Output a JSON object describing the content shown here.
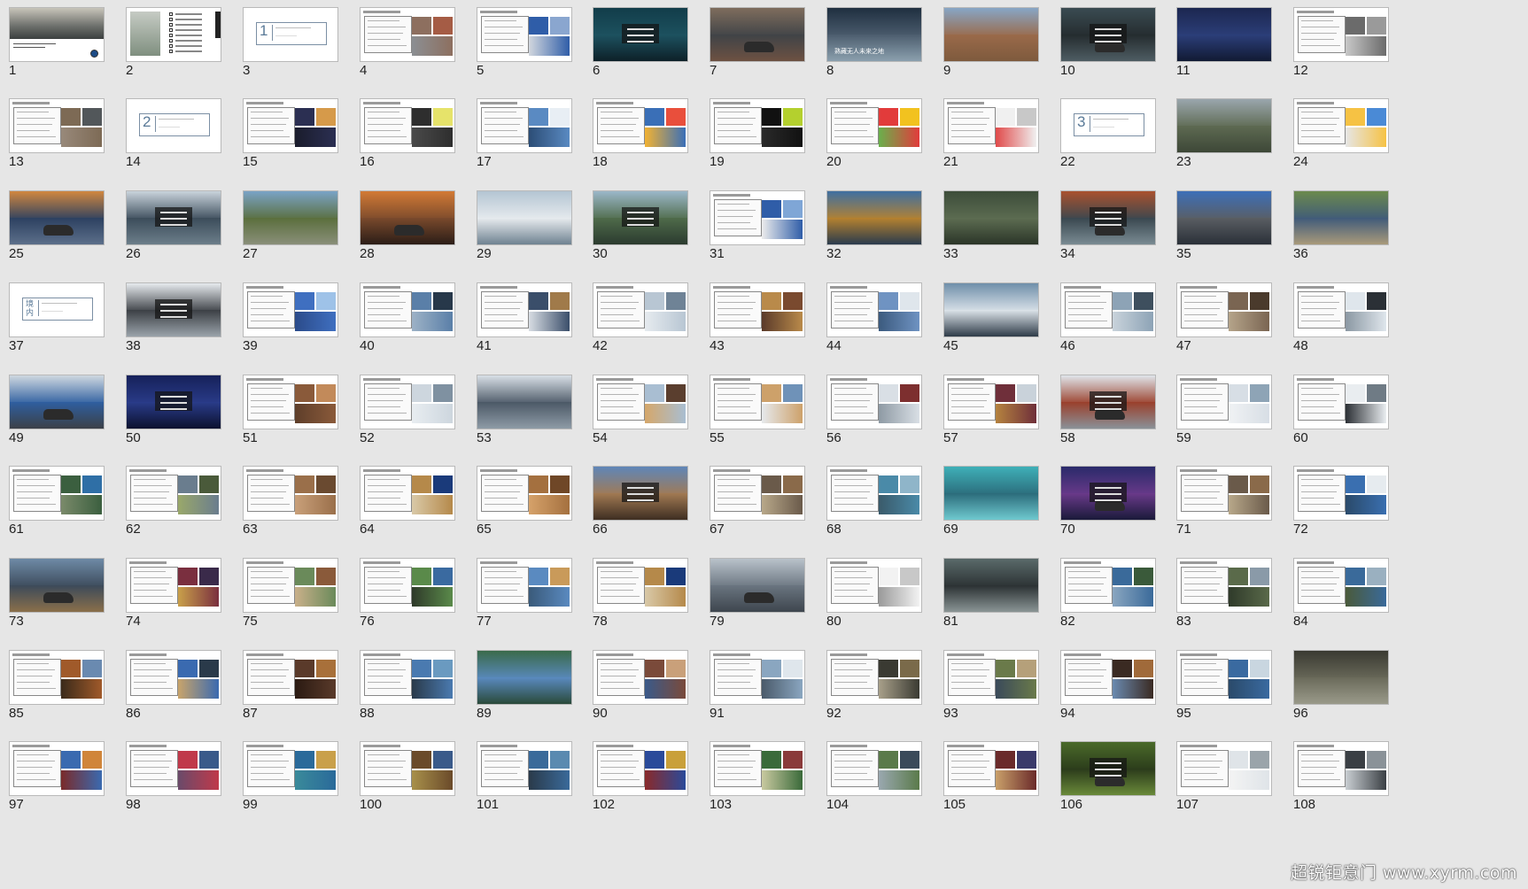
{
  "slide_sorter": {
    "slides": [
      {
        "n": "1",
        "k": "cover",
        "c": [
          "#6b6e6a",
          "#c8c4ba",
          "#3b3f3f"
        ]
      },
      {
        "n": "2",
        "k": "toc",
        "c": [
          "#7f8f7f",
          "#c6cbc4",
          "#6b7a68"
        ]
      },
      {
        "n": "3",
        "k": "section",
        "num": "1",
        "c": []
      },
      {
        "n": "4",
        "k": "white",
        "c": [
          "#8d6f5f",
          "#a55c45",
          "#8b8f93"
        ]
      },
      {
        "n": "5",
        "k": "white",
        "c": [
          "#2f5da8",
          "#8aa6cf",
          "#d2d7de"
        ]
      },
      {
        "n": "6",
        "k": "photo",
        "c": [
          "#123d4a",
          "#1d5260",
          "#0d2028"
        ]
      },
      {
        "n": "7",
        "k": "photo",
        "c": [
          "#7f6d5d",
          "#3f4347",
          "#6d5142"
        ]
      },
      {
        "n": "8",
        "k": "photo",
        "c": [
          "#1f2f40",
          "#4c5d6e",
          "#8ba0ae"
        ],
        "t": "熟藏无人未来之地"
      },
      {
        "n": "9",
        "k": "photo",
        "c": [
          "#87a6c6",
          "#9a6a4a",
          "#7e5a3d"
        ]
      },
      {
        "n": "10",
        "k": "photo",
        "c": [
          "#3a4b52",
          "#242b2e",
          "#4e5d63"
        ]
      },
      {
        "n": "11",
        "k": "photo",
        "c": [
          "#1c2750",
          "#2c3f7a",
          "#111a33"
        ]
      },
      {
        "n": "12",
        "k": "white",
        "c": [
          "#6b6b6b",
          "#9a9a9a",
          "#c8c8c8"
        ]
      },
      {
        "n": "13",
        "k": "white",
        "c": [
          "#7d6a55",
          "#52575a",
          "#98897a"
        ]
      },
      {
        "n": "14",
        "k": "section",
        "num": "2",
        "c": []
      },
      {
        "n": "15",
        "k": "white",
        "c": [
          "#2b2f52",
          "#d69a4a",
          "#1a1c2c"
        ]
      },
      {
        "n": "16",
        "k": "white",
        "c": [
          "#2e2e2e",
          "#e6e36a",
          "#4a4a4a"
        ]
      },
      {
        "n": "17",
        "k": "white",
        "c": [
          "#5a8ac2",
          "#e8eef4",
          "#2c4d76"
        ]
      },
      {
        "n": "18",
        "k": "white",
        "c": [
          "#3a6fb7",
          "#e94f3c",
          "#f2b233"
        ]
      },
      {
        "n": "19",
        "k": "white",
        "c": [
          "#111111",
          "#b4d02e",
          "#2a2a2a"
        ]
      },
      {
        "n": "20",
        "k": "white",
        "c": [
          "#e23b3b",
          "#f2c21f",
          "#6ab04c"
        ]
      },
      {
        "n": "21",
        "k": "white",
        "c": [
          "#f0f0f0",
          "#c8c8c8",
          "#e04a4a"
        ]
      },
      {
        "n": "22",
        "k": "section",
        "num": "3",
        "c": []
      },
      {
        "n": "23",
        "k": "photo",
        "c": [
          "#9aa6ad",
          "#5e6a52",
          "#3d4737"
        ]
      },
      {
        "n": "24",
        "k": "white",
        "c": [
          "#f6c244",
          "#4a8ad6",
          "#e6e6e6"
        ]
      },
      {
        "n": "25",
        "k": "photo",
        "c": [
          "#d1873f",
          "#2c4060",
          "#5c6f8a"
        ]
      },
      {
        "n": "26",
        "k": "photo",
        "c": [
          "#c9d3dc",
          "#3b4c5a",
          "#6c7e8a"
        ]
      },
      {
        "n": "27",
        "k": "photo",
        "c": [
          "#7aa3c6",
          "#5a6e3c",
          "#8a8f7a"
        ]
      },
      {
        "n": "28",
        "k": "photo",
        "c": [
          "#d27a35",
          "#7a4a2c",
          "#2b1d17"
        ]
      },
      {
        "n": "29",
        "k": "photo",
        "c": [
          "#b4c5d3",
          "#e8ecef",
          "#6f8291"
        ]
      },
      {
        "n": "30",
        "k": "photo",
        "c": [
          "#9bb7c9",
          "#4f6b4a",
          "#2b3b2f"
        ]
      },
      {
        "n": "31",
        "k": "white",
        "c": [
          "#2f5da8",
          "#7fa6d6",
          "#ececec"
        ]
      },
      {
        "n": "32",
        "k": "photo",
        "c": [
          "#3f6fa1",
          "#b7822e",
          "#2a3b4d"
        ]
      },
      {
        "n": "33",
        "k": "photo",
        "c": [
          "#3d4d3a",
          "#5d6d52",
          "#2b3528"
        ]
      },
      {
        "n": "34",
        "k": "photo",
        "c": [
          "#a9522f",
          "#39474f",
          "#7a8b93"
        ]
      },
      {
        "n": "35",
        "k": "photo",
        "c": [
          "#3d6fb8",
          "#5a5e63",
          "#2a3038"
        ]
      },
      {
        "n": "36",
        "k": "photo",
        "c": [
          "#6c8a4d",
          "#3f5a7a",
          "#a99a7a"
        ]
      },
      {
        "n": "37",
        "k": "section",
        "num": "境内",
        "c": []
      },
      {
        "n": "38",
        "k": "photo",
        "c": [
          "#e6eaee",
          "#3b3f44",
          "#9aa3aa"
        ]
      },
      {
        "n": "39",
        "k": "white",
        "c": [
          "#3f6fc0",
          "#9ec2e8",
          "#2b4b8a"
        ]
      },
      {
        "n": "40",
        "k": "white",
        "c": [
          "#5a7fa8",
          "#27384a",
          "#9db2c6"
        ]
      },
      {
        "n": "41",
        "k": "white",
        "c": [
          "#3a4e6a",
          "#a07a4a",
          "#d8dde3"
        ]
      },
      {
        "n": "42",
        "k": "white",
        "c": [
          "#b8c6d3",
          "#6f8396",
          "#e6ebef"
        ]
      },
      {
        "n": "43",
        "k": "white",
        "c": [
          "#b98a4a",
          "#7a4a2f",
          "#5a3a2a"
        ]
      },
      {
        "n": "44",
        "k": "white",
        "c": [
          "#6f93c2",
          "#dfe6ec",
          "#3b5a7e"
        ]
      },
      {
        "n": "45",
        "k": "photo",
        "c": [
          "#6f8faa",
          "#dde4ea",
          "#2e3b48"
        ]
      },
      {
        "n": "46",
        "k": "white",
        "c": [
          "#8da3b6",
          "#3e4f5e",
          "#c9d3db"
        ]
      },
      {
        "n": "47",
        "k": "white",
        "c": [
          "#7a6552",
          "#4a3a2c",
          "#b5a48a"
        ]
      },
      {
        "n": "48",
        "k": "white",
        "c": [
          "#dfe6ec",
          "#2b3036",
          "#8b98a3"
        ]
      },
      {
        "n": "49",
        "k": "photo",
        "c": [
          "#cfd8e0",
          "#2f5fa0",
          "#3b4047"
        ]
      },
      {
        "n": "50",
        "k": "photo",
        "c": [
          "#16215a",
          "#2a3c8a",
          "#0b112e"
        ]
      },
      {
        "n": "51",
        "k": "white",
        "c": [
          "#8a5a3a",
          "#c28a5a",
          "#5e3e2a"
        ]
      },
      {
        "n": "52",
        "k": "white",
        "c": [
          "#cdd6de",
          "#7f91a1",
          "#e8edf1"
        ]
      },
      {
        "n": "53",
        "k": "photo",
        "c": [
          "#d8dfe6",
          "#4b5866",
          "#8e9ba6"
        ]
      },
      {
        "n": "54",
        "k": "white",
        "c": [
          "#a9bed2",
          "#5a3e2e",
          "#d5a76a"
        ]
      },
      {
        "n": "55",
        "k": "white",
        "c": [
          "#cda16a",
          "#6f92b8",
          "#e6e9ec"
        ]
      },
      {
        "n": "56",
        "k": "white",
        "c": [
          "#d9dfe5",
          "#7d2f2f",
          "#8e9aa4"
        ]
      },
      {
        "n": "57",
        "k": "white",
        "c": [
          "#6f2f3a",
          "#c9d2da",
          "#b5833f"
        ]
      },
      {
        "n": "58",
        "k": "photo",
        "c": [
          "#dfe5ea",
          "#9a3f2b",
          "#8a9198"
        ]
      },
      {
        "n": "59",
        "k": "white",
        "c": [
          "#d7dee5",
          "#8ea4b6",
          "#f0f2f4"
        ]
      },
      {
        "n": "60",
        "k": "white",
        "c": [
          "#e9edf0",
          "#6f7b85",
          "#2c3035"
        ]
      },
      {
        "n": "61",
        "k": "white",
        "c": [
          "#3b5f3f",
          "#2f6fa6",
          "#7a8a6a"
        ]
      },
      {
        "n": "62",
        "k": "white",
        "c": [
          "#6a7d8e",
          "#4a5a3a",
          "#9aa86a"
        ]
      },
      {
        "n": "63",
        "k": "white",
        "c": [
          "#9a6f4a",
          "#6a4a30",
          "#c9a07a"
        ]
      },
      {
        "n": "64",
        "k": "white",
        "c": [
          "#b5894a",
          "#1a3a7a",
          "#d9c9a8"
        ]
      },
      {
        "n": "65",
        "k": "white",
        "c": [
          "#a4703f",
          "#6f4727",
          "#d6a26a"
        ]
      },
      {
        "n": "66",
        "k": "photo",
        "c": [
          "#5f86b8",
          "#a27a53",
          "#3e2e22"
        ]
      },
      {
        "n": "67",
        "k": "white",
        "c": [
          "#6a5a4a",
          "#8a6a4a",
          "#b8a88a"
        ]
      },
      {
        "n": "68",
        "k": "white",
        "c": [
          "#4a8aa8",
          "#8fb5c9",
          "#3a5a6a"
        ]
      },
      {
        "n": "69",
        "k": "photo",
        "c": [
          "#3fb0b8",
          "#2b6b7a",
          "#6fc9cf"
        ]
      },
      {
        "n": "70",
        "k": "photo",
        "c": [
          "#2a2a6a",
          "#6a3a8a",
          "#1a1a3a"
        ]
      },
      {
        "n": "71",
        "k": "white",
        "c": [
          "#6a5a4a",
          "#8a6a4a",
          "#b8a88a"
        ]
      },
      {
        "n": "72",
        "k": "white",
        "c": [
          "#3a6fb0",
          "#e6ebef",
          "#2a4a6a"
        ]
      },
      {
        "n": "73",
        "k": "photo",
        "c": [
          "#6e8aa6",
          "#3c4a5a",
          "#8a6f4a"
        ]
      },
      {
        "n": "74",
        "k": "white",
        "c": [
          "#7a2f3f",
          "#3a2a4a",
          "#c9a04a"
        ]
      },
      {
        "n": "75",
        "k": "white",
        "c": [
          "#6a8a5a",
          "#8a5a3a",
          "#c9b08a"
        ]
      },
      {
        "n": "76",
        "k": "white",
        "c": [
          "#5a8a4a",
          "#3a6aa0",
          "#2f3a2a"
        ]
      },
      {
        "n": "77",
        "k": "white",
        "c": [
          "#5a8ac0",
          "#c99a5a",
          "#3a5a7a"
        ]
      },
      {
        "n": "78",
        "k": "white",
        "c": [
          "#b5894a",
          "#1a3a7a",
          "#d9c9a8"
        ]
      },
      {
        "n": "79",
        "k": "photo",
        "c": [
          "#b9c2ca",
          "#6a7580",
          "#3e464e"
        ]
      },
      {
        "n": "80",
        "k": "white",
        "c": [
          "#f2f2f2",
          "#c8c8c8",
          "#9a9a9a"
        ]
      },
      {
        "n": "81",
        "k": "photo",
        "c": [
          "#5a6a6a",
          "#2a3032",
          "#8a9595"
        ]
      },
      {
        "n": "82",
        "k": "white",
        "c": [
          "#3a6a9a",
          "#3a5a3a",
          "#8aa6c0"
        ]
      },
      {
        "n": "83",
        "k": "white",
        "c": [
          "#5a6a4a",
          "#8a9aa8",
          "#2f3a2a"
        ]
      },
      {
        "n": "84",
        "k": "white",
        "c": [
          "#3a6a9a",
          "#9ab0c0",
          "#4a5a3a"
        ]
      },
      {
        "n": "85",
        "k": "white",
        "c": [
          "#a05a2a",
          "#6a8ab0",
          "#3a2a1a"
        ]
      },
      {
        "n": "86",
        "k": "white",
        "c": [
          "#3a6ab0",
          "#2a3a4a",
          "#c9a46a"
        ]
      },
      {
        "n": "87",
        "k": "white",
        "c": [
          "#5a3a2a",
          "#a8703a",
          "#2a1a12"
        ]
      },
      {
        "n": "88",
        "k": "white",
        "c": [
          "#4a7ab0",
          "#6a9ac0",
          "#2a3a4a"
        ]
      },
      {
        "n": "89",
        "k": "photo",
        "c": [
          "#3a6a4a",
          "#5a8ac0",
          "#2a4a3a"
        ]
      },
      {
        "n": "90",
        "k": "white",
        "c": [
          "#7a4a3a",
          "#c9a07a",
          "#3a5a8a"
        ]
      },
      {
        "n": "91",
        "k": "white",
        "c": [
          "#8aa6c0",
          "#dfe6ec",
          "#4a5a6a"
        ]
      },
      {
        "n": "92",
        "k": "white",
        "c": [
          "#3a3a32",
          "#7a6a4a",
          "#a8a08a"
        ]
      },
      {
        "n": "93",
        "k": "white",
        "c": [
          "#6a7a4a",
          "#b5a07a",
          "#3a4a5a"
        ]
      },
      {
        "n": "94",
        "k": "white",
        "c": [
          "#3a2a22",
          "#a06a3a",
          "#6a8ab0"
        ]
      },
      {
        "n": "95",
        "k": "white",
        "c": [
          "#3a6aa0",
          "#c9d6e0",
          "#2a4a6a"
        ]
      },
      {
        "n": "96",
        "k": "photo",
        "c": [
          "#3a3a32",
          "#6a6a5a",
          "#9a9a8a"
        ]
      },
      {
        "n": "97",
        "k": "white",
        "c": [
          "#3a6ab0",
          "#d0853a",
          "#7a2a2a"
        ]
      },
      {
        "n": "98",
        "k": "white",
        "c": [
          "#c0394a",
          "#3a5a8a",
          "#6a4a6a"
        ]
      },
      {
        "n": "99",
        "k": "white",
        "c": [
          "#2a6a9a",
          "#c9a04a",
          "#3a8a9a"
        ]
      },
      {
        "n": "100",
        "k": "white",
        "c": [
          "#6a4a2a",
          "#3a5a8a",
          "#a8904a"
        ]
      },
      {
        "n": "101",
        "k": "white",
        "c": [
          "#3a6a9a",
          "#5a8ab0",
          "#2a3a4a"
        ]
      },
      {
        "n": "102",
        "k": "white",
        "c": [
          "#2a4a9a",
          "#c9a03a",
          "#8a2a2a"
        ]
      },
      {
        "n": "103",
        "k": "white",
        "c": [
          "#3a6a3a",
          "#8a3a3a",
          "#c9c9a0"
        ]
      },
      {
        "n": "104",
        "k": "white",
        "c": [
          "#5a7a4a",
          "#3a4a5a",
          "#9aa8b0"
        ]
      },
      {
        "n": "105",
        "k": "white",
        "c": [
          "#6a2a2a",
          "#3a3a6a",
          "#c9a06a"
        ]
      },
      {
        "n": "106",
        "k": "photo",
        "c": [
          "#4a6a2a",
          "#2a3a1a",
          "#6a8a3a"
        ]
      },
      {
        "n": "107",
        "k": "white",
        "c": [
          "#dfe4e8",
          "#9aa4aa",
          "#f4f4f4"
        ]
      },
      {
        "n": "108",
        "k": "white",
        "c": [
          "#3a3f44",
          "#8a9298",
          "#c9ced2"
        ]
      }
    ]
  },
  "watermark": "超锐钜意门 www.xyrm.com"
}
